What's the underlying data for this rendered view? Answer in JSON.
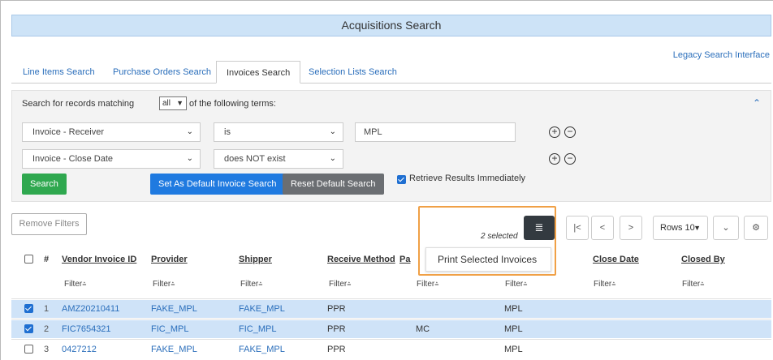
{
  "title": "Acquisitions Search",
  "legacy_link": "Legacy Search Interface",
  "tabs": [
    {
      "label": "Line Items Search"
    },
    {
      "label": "Purchase Orders Search"
    },
    {
      "label": "Invoices Search",
      "active": true
    },
    {
      "label": "Selection Lists Search"
    }
  ],
  "search": {
    "prefix": "Search for records matching",
    "match_value": "all",
    "suffix": "of the following terms:",
    "terms": [
      {
        "field": "Invoice - Receiver",
        "operator": "is",
        "value": "MPL"
      },
      {
        "field": "Invoice - Close Date",
        "operator": "does NOT exist",
        "value": ""
      }
    ],
    "search_button": "Search",
    "set_default_button": "Set As Default Invoice Search",
    "reset_default_button": "Reset Default Search",
    "retrieve_label": "Retrieve Results Immediately",
    "retrieve_checked": true
  },
  "grid": {
    "remove_filters": "Remove Filters",
    "selected_text": "2 selected",
    "rows_label": "Rows 10",
    "print_menu_item": "Print Selected Invoices",
    "filter_label": "Filter",
    "columns": [
      {
        "label": "#"
      },
      {
        "label": "Vendor Invoice ID"
      },
      {
        "label": "Provider"
      },
      {
        "label": "Shipper"
      },
      {
        "label": "Receive Method"
      },
      {
        "label": "Pa"
      },
      {
        "label": "Close Date"
      },
      {
        "label": "Closed By"
      }
    ],
    "rows": [
      {
        "num": "1",
        "invoice_id": "AMZ20210411",
        "provider": "FAKE_MPL",
        "shipper": "FAKE_MPL",
        "method": "PPR",
        "payment": "",
        "receiver": "MPL",
        "selected": true
      },
      {
        "num": "2",
        "invoice_id": "FIC7654321",
        "provider": "FIC_MPL",
        "shipper": "FIC_MPL",
        "method": "PPR",
        "payment": "MC",
        "receiver": "MPL",
        "selected": true
      },
      {
        "num": "3",
        "invoice_id": "0427212",
        "provider": "FAKE_MPL",
        "shipper": "FAKE_MPL",
        "method": "PPR",
        "payment": "",
        "receiver": "MPL",
        "selected": false
      }
    ]
  },
  "colors": {
    "title_bg": "#cde3f7",
    "link": "#2a6ebb",
    "green_btn": "#2fa84f",
    "blue_btn": "#1f7ae0",
    "grey_btn": "#6b6e72",
    "highlight": "#f0a046",
    "selected_row": "#cfe3f8"
  }
}
